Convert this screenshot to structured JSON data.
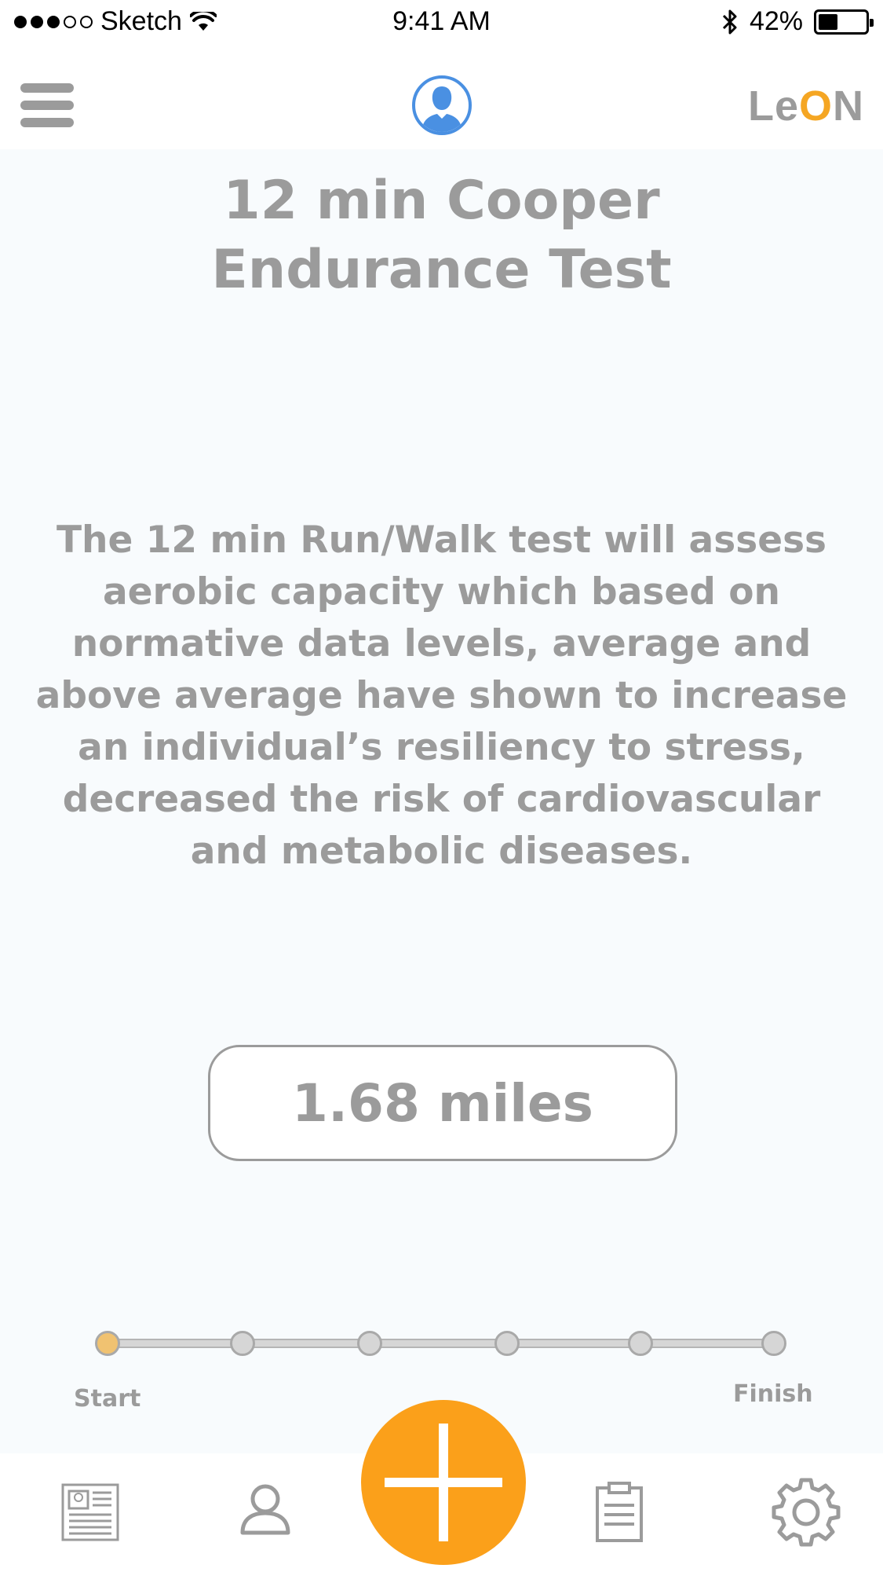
{
  "status_bar": {
    "carrier": "Sketch",
    "time": "9:41 AM",
    "battery_percent": "42%",
    "battery_level": 0.42,
    "signal_bars_filled": 3,
    "signal_bars_total": 5
  },
  "header": {
    "logo_text": "LeON",
    "logo_parts": [
      "Le",
      "O",
      "N"
    ],
    "menu_icon": "hamburger-menu-icon",
    "avatar_icon": "user-avatar-icon"
  },
  "main": {
    "title_line1": "12 min Cooper",
    "title_line2": "Endurance Test",
    "description": "The 12 min Run/Walk test will assess aerobic capacity which based on normative data levels, average and above average have shown to increase an individual’s resiliency to stress, decreased the risk of cardiovascular and metabolic diseases.",
    "distance_value": "1.68 miles"
  },
  "progress": {
    "start_label": "Start",
    "finish_label": "Finish",
    "total_steps": 6,
    "current_step": 1
  },
  "tab_bar": {
    "items": [
      {
        "name": "news",
        "icon": "newspaper-icon"
      },
      {
        "name": "profile",
        "icon": "user-icon"
      },
      {
        "name": "add",
        "icon": "plus-icon"
      },
      {
        "name": "clipboard",
        "icon": "clipboard-icon"
      },
      {
        "name": "settings",
        "icon": "gear-icon"
      }
    ]
  },
  "colors": {
    "accent_orange": "#fba01a",
    "avatar_blue": "#4a90e2",
    "text_gray": "#9b9b9b",
    "active_step": "#f0c271"
  }
}
